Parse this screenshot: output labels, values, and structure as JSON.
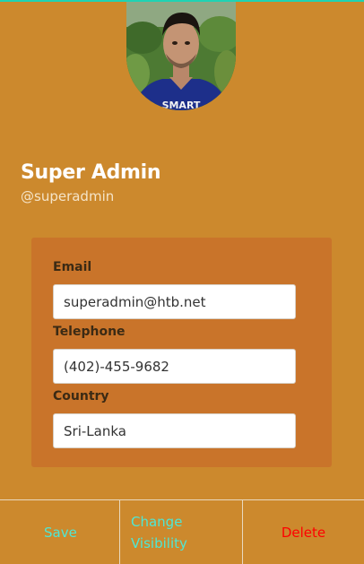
{
  "profile": {
    "name": "Super Admin",
    "handle": "@superadmin"
  },
  "form": {
    "email": {
      "label": "Email",
      "value": "superadmin@htb.net"
    },
    "telephone": {
      "label": "Telephone",
      "value": "(402)-455-9682"
    },
    "country": {
      "label": "Country",
      "value": "Sri-Lanka"
    }
  },
  "actions": {
    "save": "Save",
    "change_visibility": "Change Visibility",
    "delete": "Delete"
  },
  "avatar": {
    "shirt_text": "SMART"
  },
  "colors": {
    "background": "#cc892d",
    "card": "#c9742a",
    "accent": "#4ee7d4",
    "danger": "#ff0000",
    "top_line": "#1fd3b3"
  }
}
